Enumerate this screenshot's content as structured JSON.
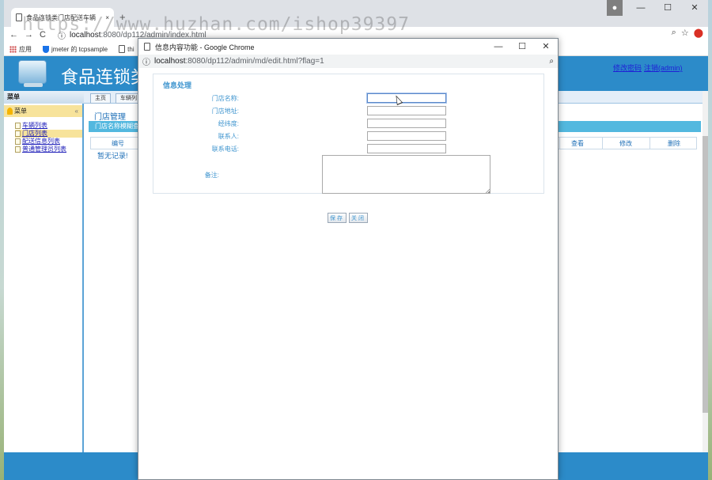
{
  "browser": {
    "tab_title": "食品连锁类门店配送车辆",
    "tab_close": "×",
    "new_tab": "+",
    "window_controls": {
      "minimize": "—",
      "maximize": "☐",
      "close": "✕"
    },
    "nav": {
      "back": "←",
      "forward": "→",
      "reload": "C"
    },
    "url": {
      "host": "localhost",
      "path": ":8080/dp112/admin/index.html"
    },
    "bookmarks": [
      {
        "label": "应用"
      },
      {
        "label": "jmeter 的 tcpsample"
      },
      {
        "label": "thi"
      }
    ]
  },
  "app": {
    "title": "食品连锁类",
    "links": {
      "change_password": "修改密码",
      "logout": "注销(admin)"
    },
    "menu": {
      "title": "菜单",
      "group": "菜单",
      "items": [
        {
          "label": "车辆列表"
        },
        {
          "label": "门店列表"
        },
        {
          "label": "配送信息列表"
        },
        {
          "label": "普通管理员列表"
        }
      ]
    },
    "tabs": [
      {
        "label": "主页"
      },
      {
        "label": "车辆列"
      }
    ],
    "section_title": "门店管理",
    "search_bar_label": "门店名称模糊查",
    "table_headers": {
      "id": "编号",
      "view": "查看",
      "edit": "修改",
      "delete": "删除"
    },
    "empty_text": "暂无记录!"
  },
  "popup": {
    "window_title": "信息内容功能 - Google Chrome",
    "url": {
      "host": "localhost",
      "path": ":8080/dp112/admin/md/edit.html?flag=1"
    },
    "form": {
      "title": "信息处理",
      "fields": [
        {
          "label": "门店名称:",
          "value": ""
        },
        {
          "label": "门店地址:",
          "value": ""
        },
        {
          "label": "经纬度:",
          "value": ""
        },
        {
          "label": "联系人:",
          "value": ""
        },
        {
          "label": "联系电话:",
          "value": ""
        }
      ],
      "remark_label": "备注:",
      "remark_value": "",
      "save_button": "保存",
      "close_button": "关闭"
    }
  },
  "watermark": "https://www.huzhan.com/ishop39397"
}
